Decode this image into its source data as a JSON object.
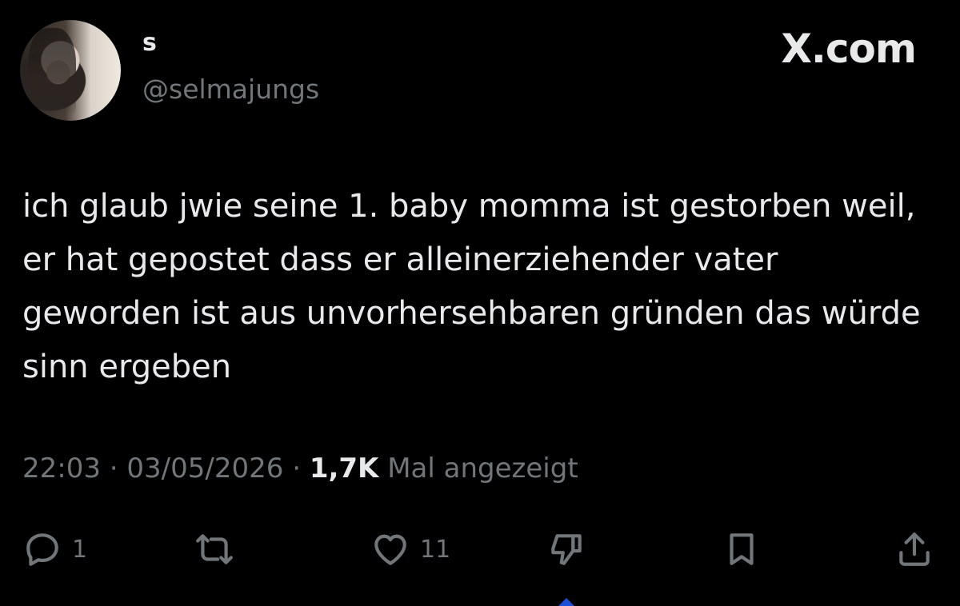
{
  "author": {
    "display_name": "s",
    "handle": "@selmajungs"
  },
  "brand": "X.com",
  "tweet": {
    "text": "ich glaub jwie seine 1. baby momma ist gestorben weil, er hat gepostet dass er alleinerziehender vater geworden ist aus unvorhersehbaren gründen das würde sinn ergeben"
  },
  "meta": {
    "time": "22:03",
    "separator": " · ",
    "date": "03/05/2026",
    "views_count": "1,7K",
    "views_label": " Mal angezeigt"
  },
  "actions": {
    "reply": {
      "icon": "reply-bubble-icon",
      "count": "1"
    },
    "repost": {
      "icon": "repost-arrows-icon"
    },
    "like": {
      "icon": "heart-icon",
      "count": "11"
    },
    "dislike": {
      "icon": "dislike-icon"
    },
    "bookmark": {
      "icon": "bookmark-icon"
    },
    "share": {
      "icon": "share-upload-icon"
    }
  },
  "colors": {
    "background": "#000000",
    "text": "#e7e9ea",
    "muted": "#71767b"
  }
}
